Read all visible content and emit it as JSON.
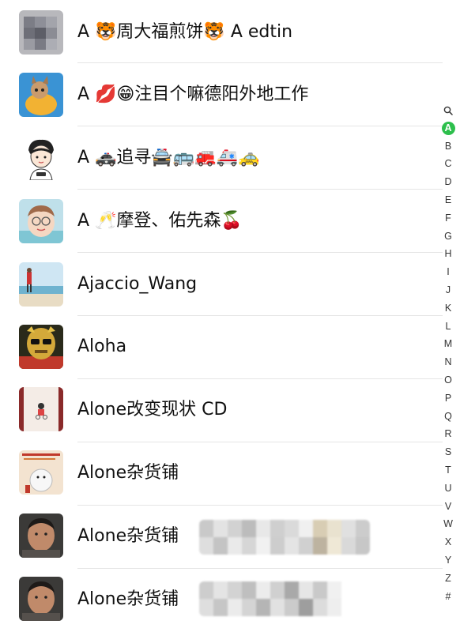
{
  "contacts": [
    {
      "name": "A 🐯周大福煎饼🐯 A edtin"
    },
    {
      "name": "A 💋😁注目个嘛德阳外地工作"
    },
    {
      "name": "A 🚓追寻🚔🚌🚒🚑🚕"
    },
    {
      "name": "A 🥂摩登、佑先森🍒"
    },
    {
      "name": "Ajaccio_Wang"
    },
    {
      "name": "Aloha"
    },
    {
      "name": "Alone改变现状 CD"
    },
    {
      "name": "Alone杂货铺"
    },
    {
      "name": "Alone杂货铺"
    },
    {
      "name": "Alone杂货铺"
    }
  ],
  "index": {
    "search_icon": "search-icon",
    "letters": [
      "A",
      "B",
      "C",
      "D",
      "E",
      "F",
      "G",
      "H",
      "I",
      "J",
      "K",
      "L",
      "M",
      "N",
      "O",
      "P",
      "Q",
      "R",
      "S",
      "T",
      "U",
      "V",
      "W",
      "X",
      "Y",
      "Z",
      "#"
    ],
    "active": "A",
    "active_color": "#2dbf4c"
  }
}
